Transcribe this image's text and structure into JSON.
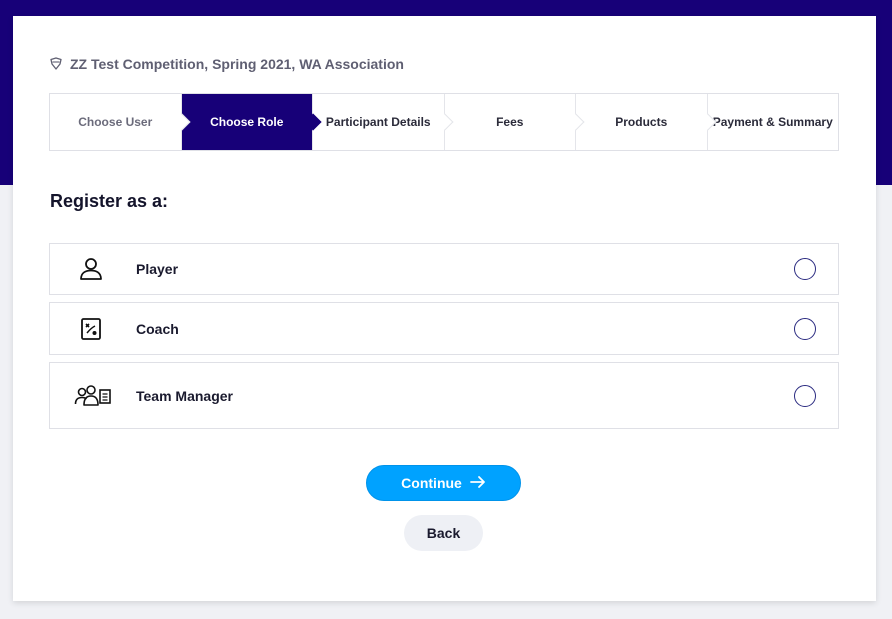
{
  "competition": {
    "icon": "shield-icon",
    "title": "ZZ Test Competition, Spring 2021, WA Association"
  },
  "steps": [
    {
      "label": "Choose User",
      "state": "done"
    },
    {
      "label": "Choose Role",
      "state": "active"
    },
    {
      "label": "Participant Details",
      "state": "pending"
    },
    {
      "label": "Fees",
      "state": "pending"
    },
    {
      "label": "Products",
      "state": "pending"
    },
    {
      "label": "Payment & Summary",
      "state": "pending"
    }
  ],
  "register": {
    "heading": "Register as a:"
  },
  "roles": [
    {
      "label": "Player",
      "icon": "person-icon",
      "selected": false
    },
    {
      "label": "Coach",
      "icon": "clipboard-tactics-icon",
      "selected": false
    },
    {
      "label": "Team Manager",
      "icon": "team-manager-icon",
      "selected": false
    }
  ],
  "actions": {
    "continue_label": "Continue",
    "continue_icon": "arrow-right-icon",
    "back_label": "Back"
  },
  "colors": {
    "brand_navy": "#170078",
    "primary_blue": "#00a2ff"
  }
}
